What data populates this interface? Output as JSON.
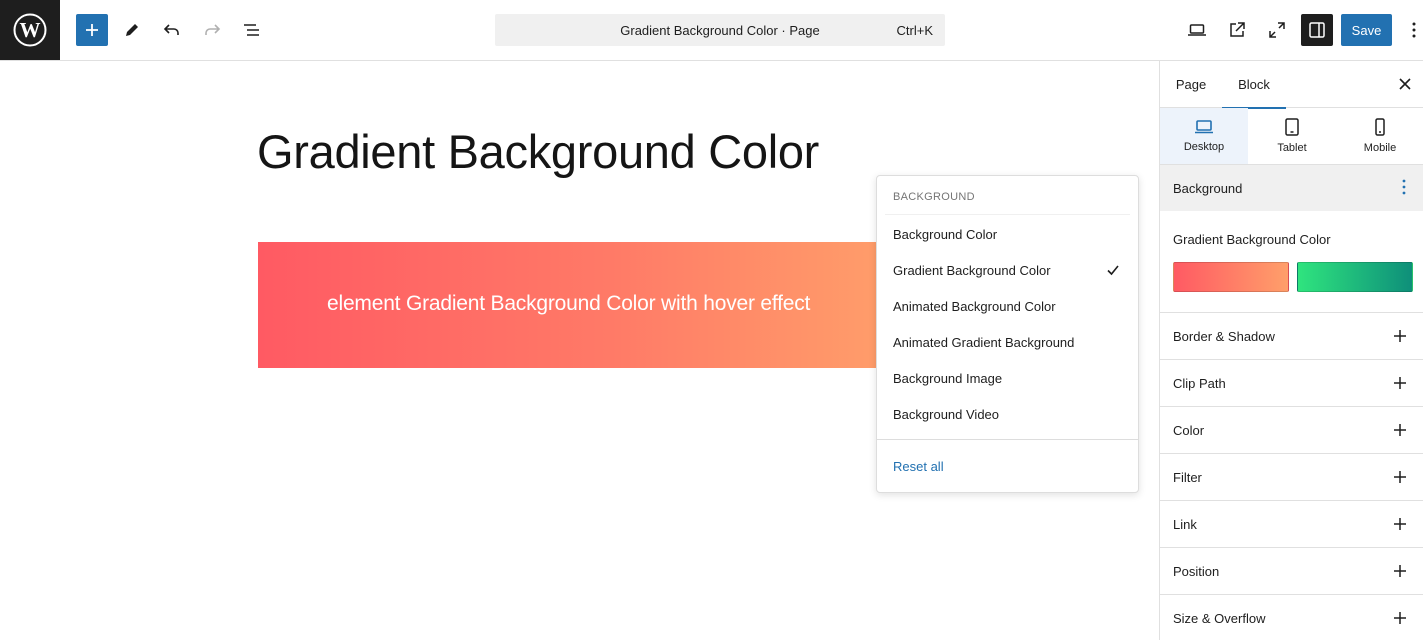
{
  "toolbar": {
    "wp_logo": "wordpress-logo",
    "icons": [
      "plus-icon",
      "pencil-icon",
      "undo-icon",
      "redo-icon",
      "list-view-icon"
    ],
    "command_title": "Gradient Background Color · Page",
    "command_shortcut": "Ctrl+K",
    "save_label": "Save",
    "accent": "#2271b1"
  },
  "canvas": {
    "title": "Gradient Background Color",
    "block_text": "element Gradient Background Color with hover effect",
    "gradient_colors": [
      "#ff5a63",
      "#ff9f6a"
    ]
  },
  "dropdown": {
    "heading": "BACKGROUND",
    "items": [
      {
        "label": "Background Color",
        "checked": false
      },
      {
        "label": "Gradient Background Color",
        "checked": true
      },
      {
        "label": "Animated Background Color",
        "checked": false
      },
      {
        "label": "Animated Gradient Background",
        "checked": false
      },
      {
        "label": "Background Image",
        "checked": false
      },
      {
        "label": "Background Video",
        "checked": false
      }
    ],
    "reset_label": "Reset all"
  },
  "sidebar": {
    "tabs": [
      {
        "label": "Page",
        "active": false
      },
      {
        "label": "Block",
        "active": true
      }
    ],
    "devices": [
      {
        "label": "Desktop",
        "icon": "desktop-icon",
        "active": true
      },
      {
        "label": "Tablet",
        "icon": "tablet-icon",
        "active": false
      },
      {
        "label": "Mobile",
        "icon": "mobile-icon",
        "active": false
      }
    ],
    "background_title": "Background",
    "gradient_label": "Gradient Background Color",
    "swatches": [
      {
        "name": "coral-gradient",
        "colors": [
          "#ff5a63",
          "#ff9f6a"
        ]
      },
      {
        "name": "green-gradient",
        "colors": [
          "#2fe47e",
          "#0e8f7a"
        ]
      }
    ],
    "panels": [
      "Border & Shadow",
      "Clip Path",
      "Color",
      "Filter",
      "Link",
      "Position",
      "Size & Overflow"
    ]
  }
}
